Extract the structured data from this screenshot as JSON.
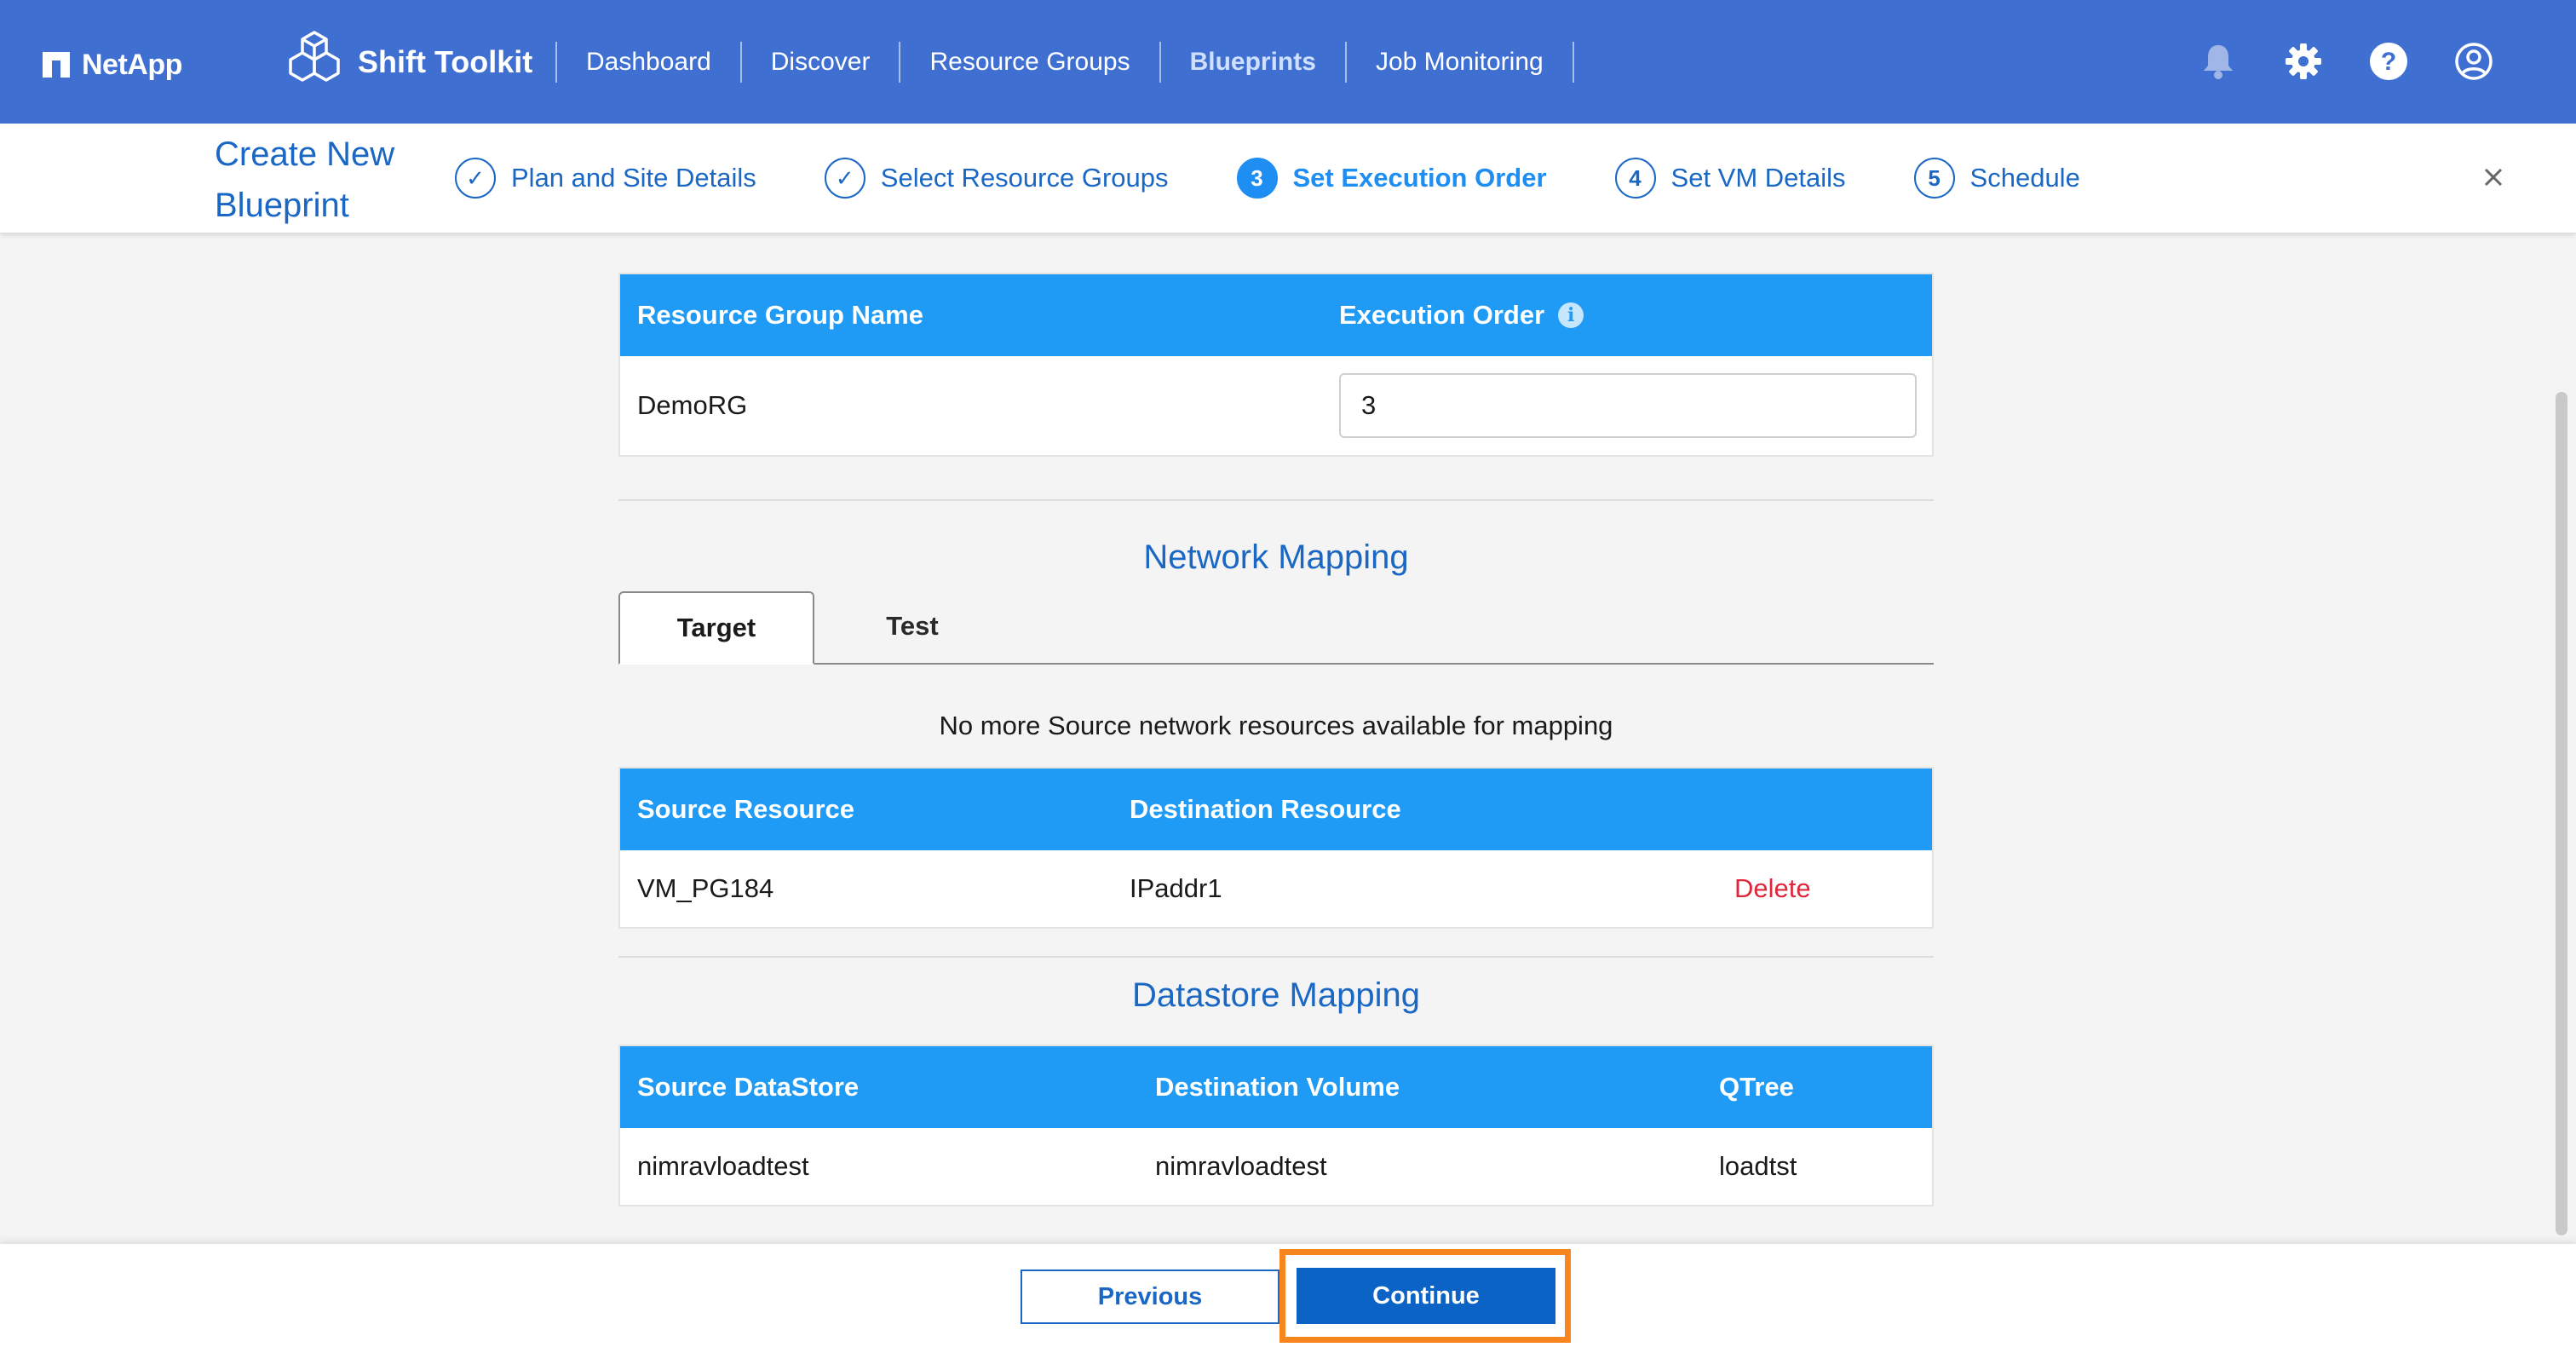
{
  "topbar": {
    "logo_text": "NetApp",
    "brand_title": "Shift Toolkit",
    "nav": [
      {
        "label": "Dashboard"
      },
      {
        "label": "Discover"
      },
      {
        "label": "Resource Groups"
      },
      {
        "label": "Blueprints",
        "active": true
      },
      {
        "label": "Job Monitoring"
      }
    ],
    "icons": [
      "bell-icon",
      "gear-icon",
      "help-icon",
      "user-account-icon"
    ]
  },
  "wizard": {
    "title_line1": "Create New",
    "title_line2": "Blueprint",
    "steps": [
      {
        "marker": "✓",
        "label": "Plan and Site Details",
        "state": "done"
      },
      {
        "marker": "✓",
        "label": "Select Resource Groups",
        "state": "done"
      },
      {
        "marker": "3",
        "label": "Set Execution Order",
        "state": "active"
      },
      {
        "marker": "4",
        "label": "Set VM Details",
        "state": "pending"
      },
      {
        "marker": "5",
        "label": "Schedule",
        "state": "pending"
      }
    ]
  },
  "resource_groups": {
    "headers": [
      "Resource Group Name",
      "Execution Order"
    ],
    "rows": [
      {
        "name": "DemoRG",
        "order": "3"
      }
    ]
  },
  "network_mapping": {
    "title": "Network Mapping",
    "tabs": [
      "Target",
      "Test"
    ],
    "active_tab": "Target",
    "message": "No more Source network resources available for mapping",
    "headers": [
      "Source Resource",
      "Destination Resource"
    ],
    "rows": [
      {
        "source": "VM_PG184",
        "destination": "IPaddr1",
        "action": "Delete"
      }
    ]
  },
  "datastore_mapping": {
    "title": "Datastore Mapping",
    "headers": [
      "Source DataStore",
      "Destination Volume",
      "QTree"
    ],
    "rows": [
      {
        "source": "nimravloadtest",
        "destination": "nimravloadtest",
        "qtree": "loadtst"
      }
    ]
  },
  "footer": {
    "previous_label": "Previous",
    "continue_label": "Continue"
  },
  "colors": {
    "topbar": "#3f6fd1",
    "table_header": "#1f9bf5",
    "accent": "#1a67c4",
    "delete": "#e0263c",
    "highlight": "#f7861f"
  }
}
